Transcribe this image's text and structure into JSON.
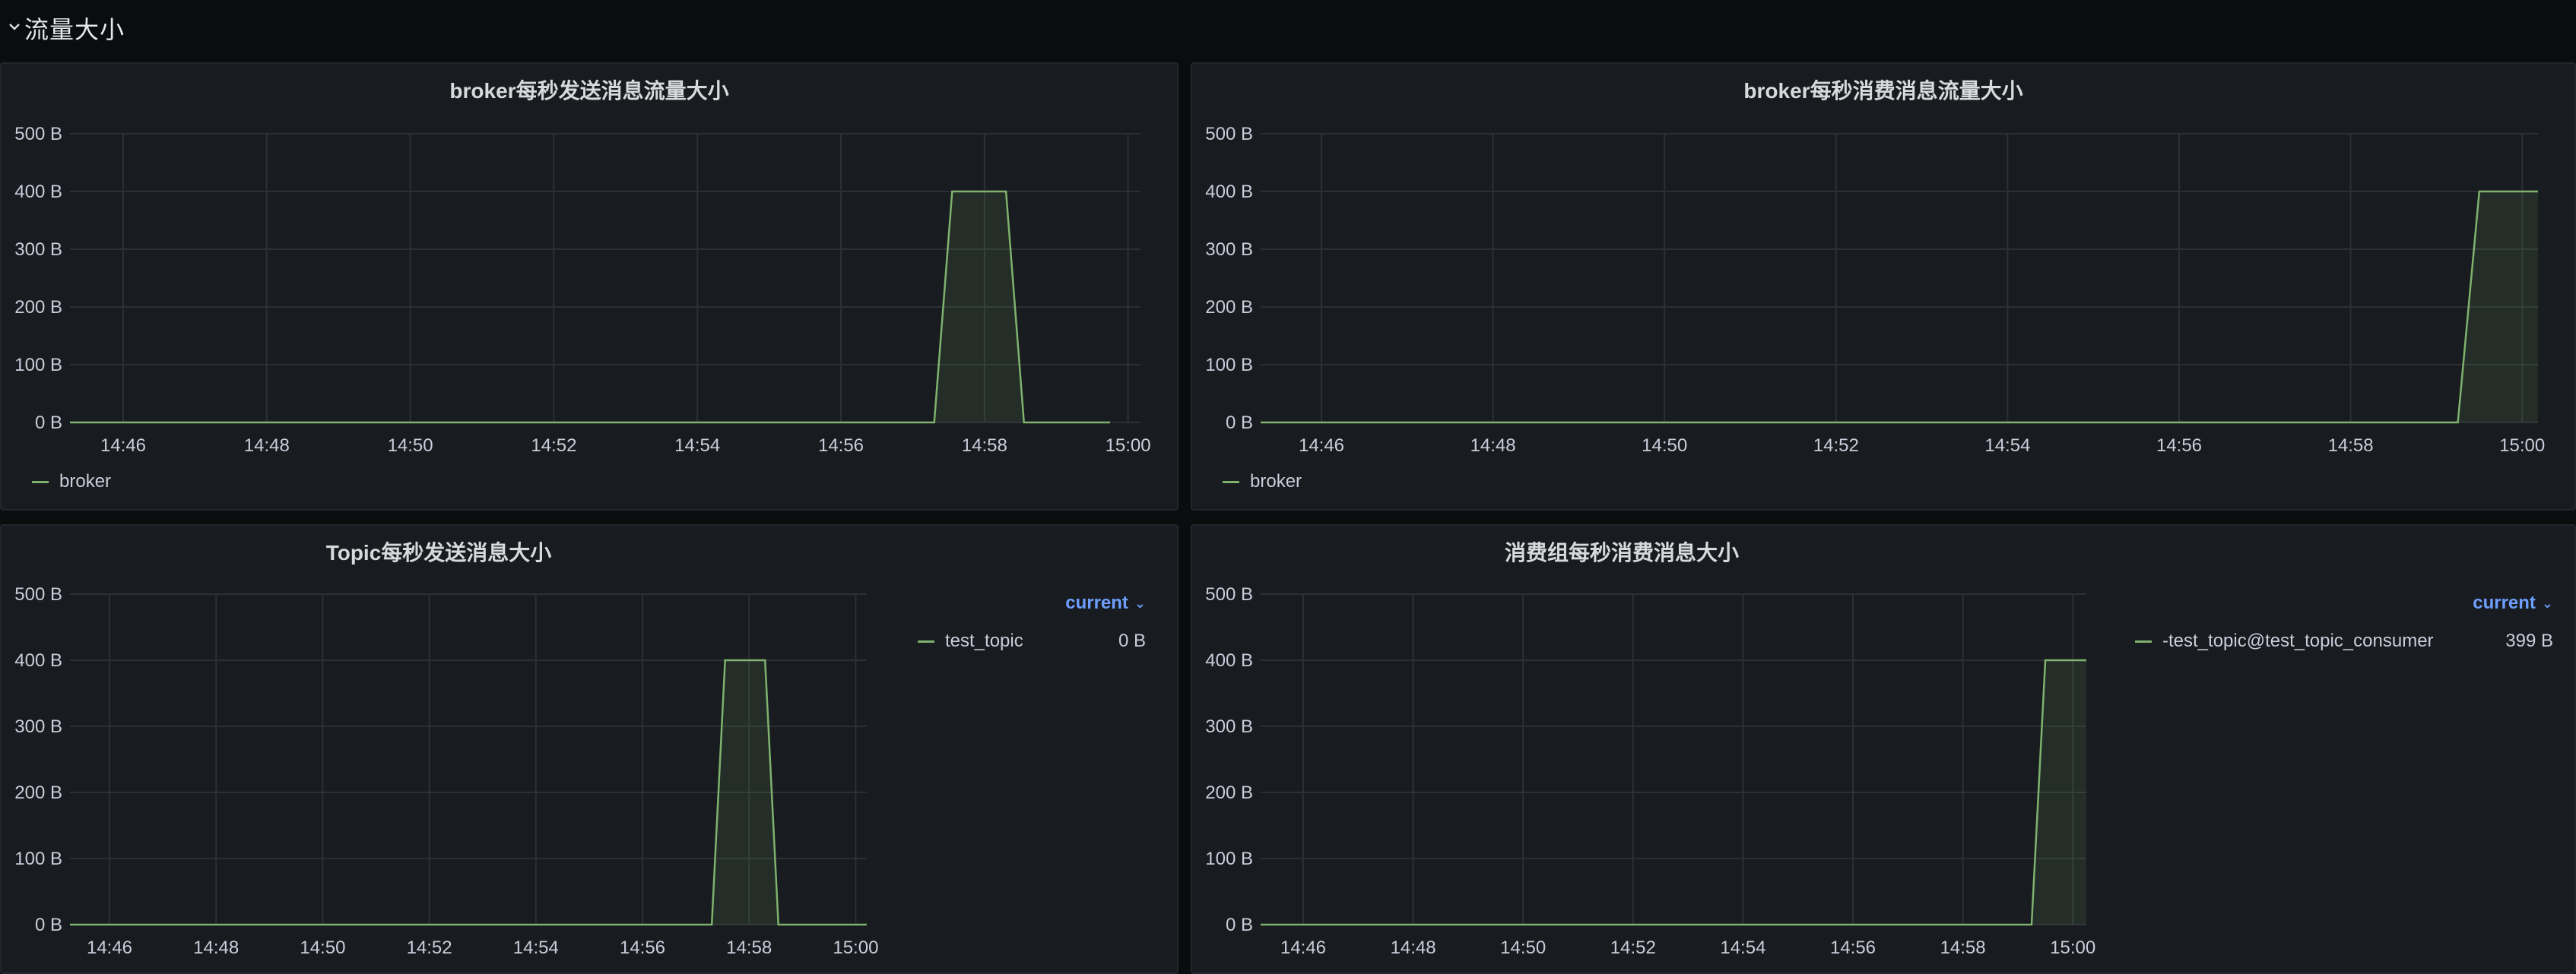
{
  "row": {
    "title": "流量大小"
  },
  "panels": [
    {
      "title": "broker每秒发送消息流量大小",
      "legend_mode": "bottom",
      "legend_items": [
        {
          "name": "broker",
          "color": "#7eb26d"
        }
      ]
    },
    {
      "title": "broker每秒消费消息流量大小",
      "legend_mode": "bottom",
      "legend_items": [
        {
          "name": "broker",
          "color": "#7eb26d"
        }
      ]
    },
    {
      "title": "Topic每秒发送消息大小",
      "legend_mode": "table",
      "legend_header": "current",
      "legend_items": [
        {
          "name": "test_topic",
          "value": "0 B",
          "color": "#7eb26d"
        }
      ]
    },
    {
      "title": "消费组每秒消费消息大小",
      "legend_mode": "table",
      "legend_header": "current",
      "legend_items": [
        {
          "name": "-test_topic@test_topic_consumer",
          "value": "399 B",
          "color": "#7eb26d"
        }
      ]
    }
  ],
  "chart_data": [
    {
      "type": "area",
      "title": "broker每秒发送消息流量大小",
      "x_ticks": [
        "14:46",
        "14:48",
        "14:50",
        "14:52",
        "14:54",
        "14:56",
        "14:58",
        "15:00"
      ],
      "y_ticks": [
        "0 B",
        "100 B",
        "200 B",
        "300 B",
        "400 B",
        "500 B"
      ],
      "ylim": [
        0,
        500
      ],
      "xlim": [
        14.6,
        15.05
      ],
      "grid": true,
      "legend": "bottom",
      "series": [
        {
          "name": "broker",
          "color": "#7eb26d",
          "x": [
            14.6,
            57.3,
            57.55,
            58.3,
            58.55,
            59.75
          ],
          "y": [
            0,
            0,
            400,
            400,
            0,
            0
          ]
        }
      ]
    },
    {
      "type": "area",
      "title": "broker每秒消费消息流量大小",
      "x_ticks": [
        "14:46",
        "14:48",
        "14:50",
        "14:52",
        "14:54",
        "14:56",
        "14:58",
        "15:00"
      ],
      "y_ticks": [
        "0 B",
        "100 B",
        "200 B",
        "300 B",
        "400 B",
        "500 B"
      ],
      "ylim": [
        0,
        500
      ],
      "grid": true,
      "legend": "bottom",
      "series": [
        {
          "name": "broker",
          "color": "#7eb26d",
          "x": [
            45.0,
            59.25,
            59.5,
            60.3
          ],
          "y": [
            0,
            0,
            400,
            400
          ]
        }
      ]
    },
    {
      "type": "area",
      "title": "Topic每秒发送消息大小",
      "x_ticks": [
        "14:46",
        "14:48",
        "14:50",
        "14:52",
        "14:54",
        "14:56",
        "14:58",
        "15:00"
      ],
      "y_ticks": [
        "0 B",
        "100 B",
        "200 B",
        "300 B",
        "400 B",
        "500 B"
      ],
      "ylim": [
        0,
        500
      ],
      "grid": true,
      "legend": "right",
      "series": [
        {
          "name": "test_topic",
          "color": "#7eb26d",
          "x": [
            45.0,
            57.3,
            57.55,
            58.3,
            58.55,
            60.25
          ],
          "y": [
            0,
            0,
            400,
            400,
            0,
            0
          ]
        }
      ]
    },
    {
      "type": "area",
      "title": "消费组每秒消费消息大小",
      "x_ticks": [
        "14:46",
        "14:48",
        "14:50",
        "14:52",
        "14:54",
        "14:56",
        "14:58",
        "15:00"
      ],
      "y_ticks": [
        "0 B",
        "100 B",
        "200 B",
        "300 B",
        "400 B",
        "500 B"
      ],
      "ylim": [
        0,
        500
      ],
      "grid": true,
      "legend": "right",
      "series": [
        {
          "name": "-test_topic@test_topic_consumer",
          "color": "#7eb26d",
          "x": [
            45.0,
            59.25,
            59.5,
            60.25
          ],
          "y": [
            0,
            0,
            400,
            400
          ]
        }
      ]
    }
  ]
}
